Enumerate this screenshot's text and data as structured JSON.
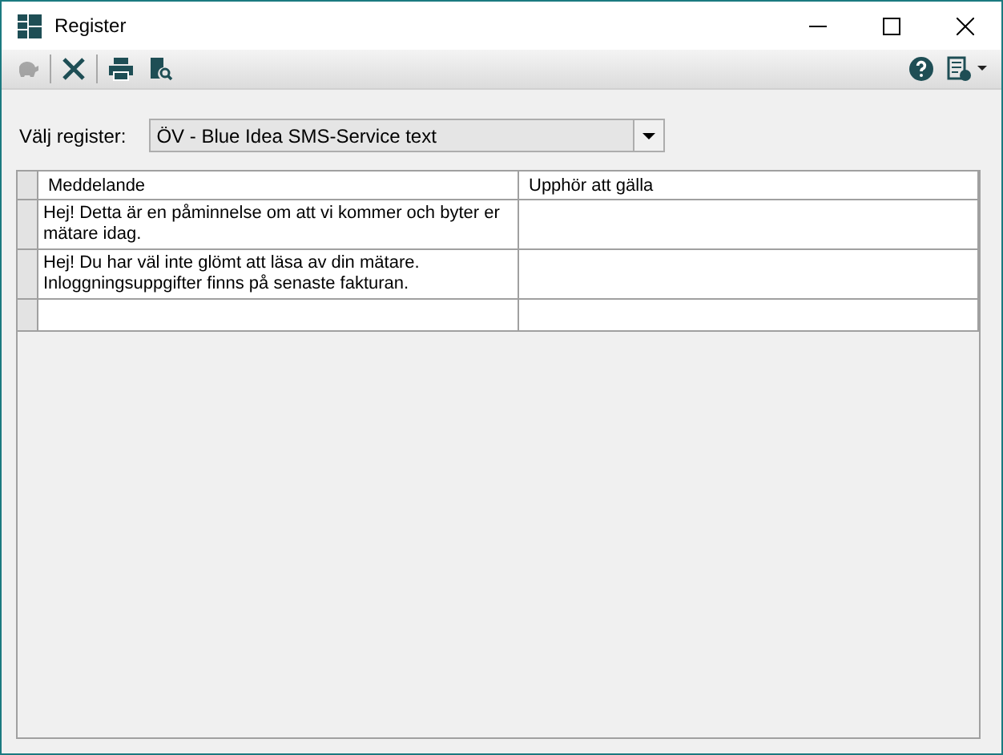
{
  "window": {
    "title": "Register"
  },
  "toolbar": [
    {
      "kind": "piggy",
      "disabled": true
    },
    {
      "kind": "separator"
    },
    {
      "kind": "delete",
      "disabled": false
    },
    {
      "kind": "separator"
    },
    {
      "kind": "print",
      "disabled": false
    },
    {
      "kind": "preview",
      "disabled": false
    }
  ],
  "toolbar_right": [
    {
      "kind": "help",
      "disabled": false
    },
    {
      "kind": "info-menu",
      "disabled": false
    }
  ],
  "register_select": {
    "label": "Välj register:",
    "value": "ÖV - Blue Idea SMS-Service text"
  },
  "table": {
    "columns": [
      "Meddelande",
      "Upphör att gälla"
    ],
    "rows": [
      {
        "cells": [
          "Hej! Detta är en påminnelse om att vi kommer och byter er\nmätare idag.",
          ""
        ]
      },
      {
        "cells": [
          "Hej! Du har väl inte glömt att läsa av din mätare.\nInloggningsuppgifter finns på senaste fakturan.",
          ""
        ]
      }
    ],
    "new_row": true
  }
}
